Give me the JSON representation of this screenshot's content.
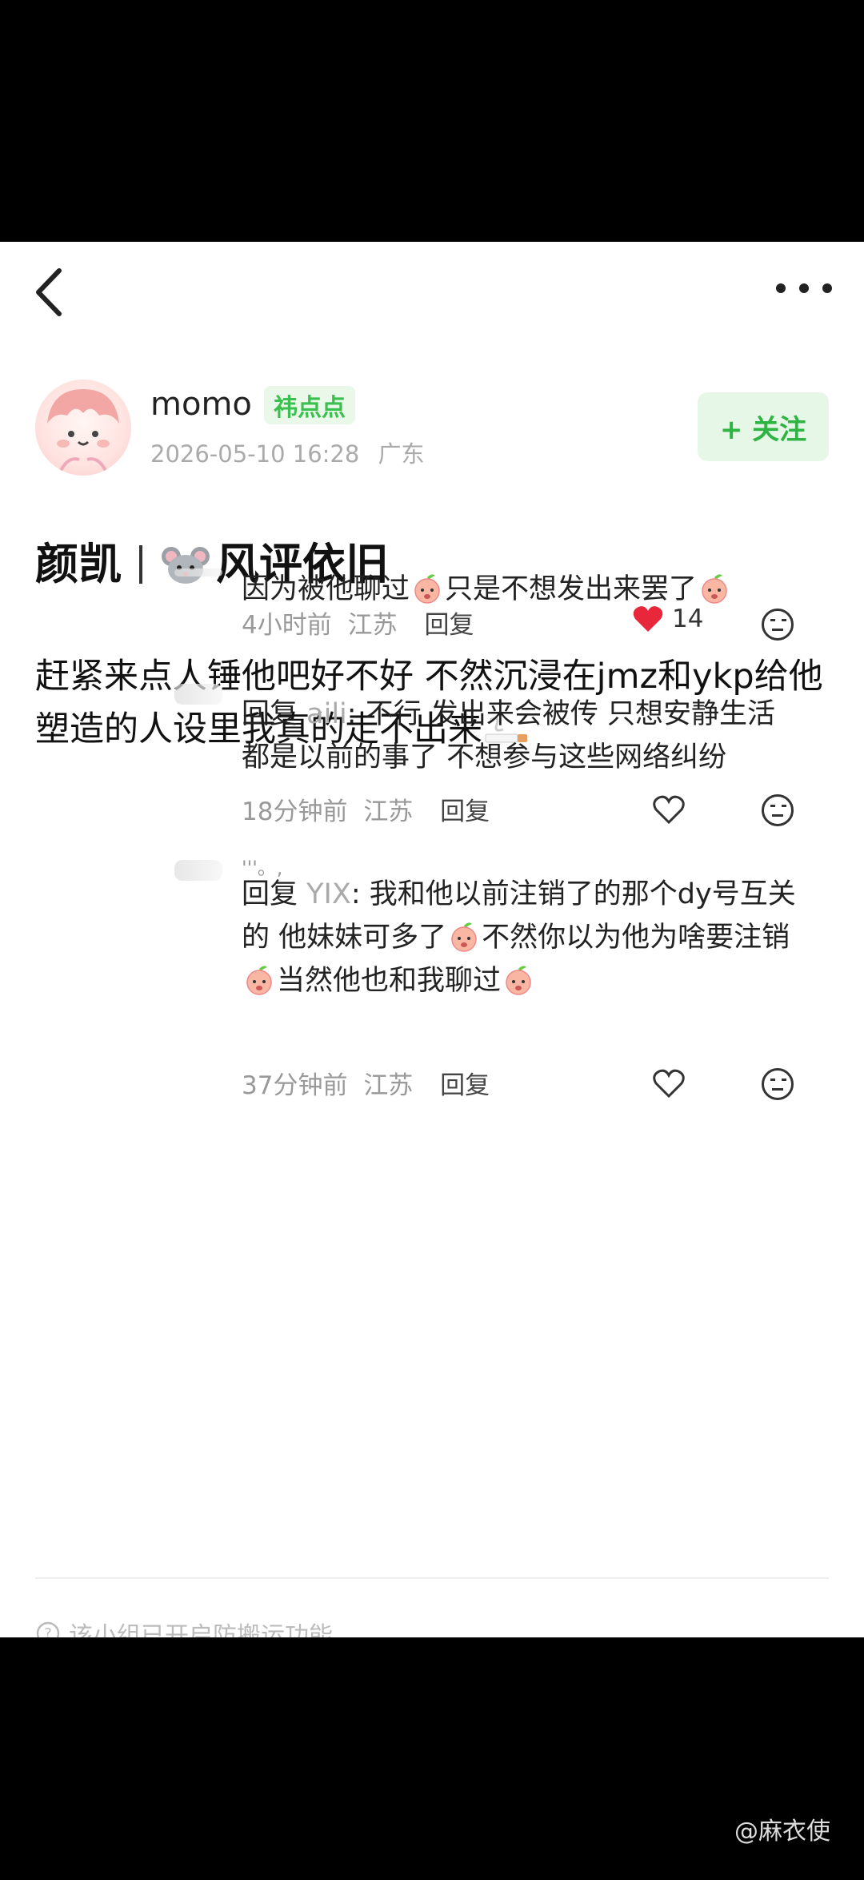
{
  "post": {
    "username": "momo",
    "badge": "祎点点",
    "timestamp": "2026-05-10 16:28",
    "location": "广东",
    "follow_label": "+ 关注",
    "title_left": "颜凯",
    "title_right": "风评依旧",
    "body": "赶紧来点人锤他吧好不好 不然沉浸在jmz和ykp给他塑造的人设里我真的走不出来"
  },
  "comments": [
    {
      "text_a": "因为被他聊过",
      "text_b": "只是不想发出来罢了",
      "time": "4小时前",
      "location": "江苏",
      "reply_label": "回复",
      "likes": "14",
      "liked": true
    },
    {
      "reply_prefix": "回复",
      "reply_to": "aili",
      "text": ": 不行 发出来会被传 只想安静生活 都是以前的事了 不想参与这些网络纠纷",
      "time": "18分钟前",
      "location": "江苏",
      "reply_label": "回复"
    },
    {
      "reply_prefix": "回复",
      "reply_to": "YIX",
      "text_a": ": 我和他以前注销了的那个dy号互关的 他妹妹可多了",
      "text_b": "不然你以为他为啥要注销",
      "text_c": "当然他也和我聊过",
      "time": "37分钟前",
      "location": "江苏",
      "reply_label": "回复",
      "name_fragment": "'''。,"
    }
  ],
  "footer": {
    "text": "该小组已开启防搬运功能"
  },
  "watermark": "@麻衣使",
  "colors": {
    "accent_green": "#2fb444",
    "like_red": "#e8283a",
    "badge_bg": "#eaf8ea"
  },
  "icons": [
    "back-arrow-icon",
    "more-dots-icon",
    "heart-icon",
    "reaction-face-icon",
    "peach-emoji-icon",
    "mouse-emoji-icon",
    "cigarette-emoji-icon",
    "question-circle-icon"
  ]
}
